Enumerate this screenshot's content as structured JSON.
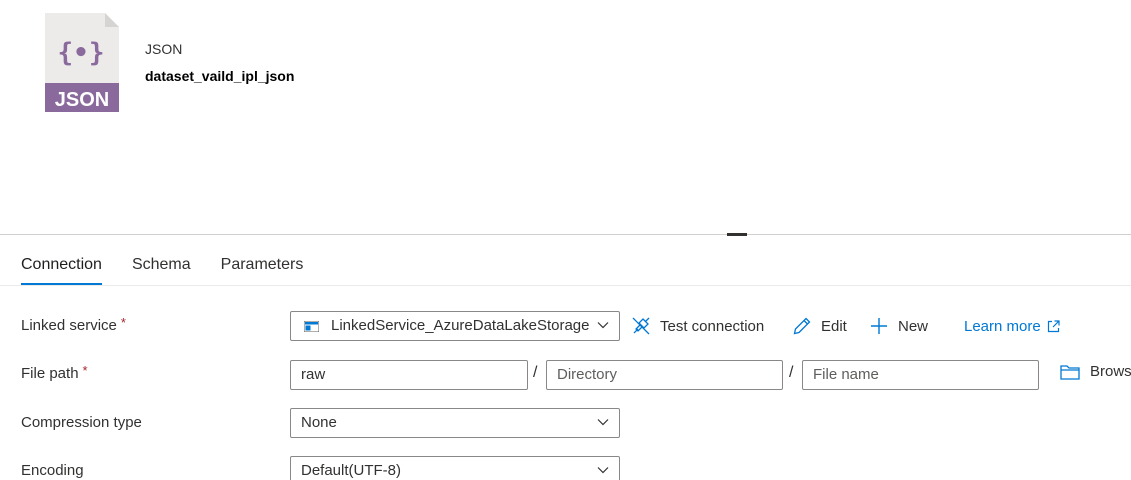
{
  "dataset": {
    "type_label": "JSON",
    "name": "dataset_vaild_ipl_json",
    "icon_badge": "JSON",
    "icon_glyph": "{•}",
    "icon_color": "#8a6a9c"
  },
  "tabs": [
    {
      "label": "Connection",
      "active": true
    },
    {
      "label": "Schema",
      "active": false
    },
    {
      "label": "Parameters",
      "active": false
    }
  ],
  "form": {
    "linked_service": {
      "label": "Linked service",
      "required_mark": "*",
      "value": "LinkedService_AzureDataLakeStorage",
      "actions": {
        "test_connection": "Test connection",
        "edit": "Edit",
        "new": "New",
        "learn_more": "Learn more"
      }
    },
    "file_path": {
      "label": "File path",
      "required_mark": "*",
      "container_value": "raw",
      "directory_placeholder": "Directory",
      "file_name_placeholder": "File name",
      "separator": "/",
      "browse_label": "Browse"
    },
    "compression_type": {
      "label": "Compression type",
      "value": "None"
    },
    "encoding": {
      "label": "Encoding",
      "value": "Default(UTF-8)"
    }
  },
  "colors": {
    "accent": "#0078d4",
    "required": "#a4262c",
    "border": "#8a8886"
  }
}
